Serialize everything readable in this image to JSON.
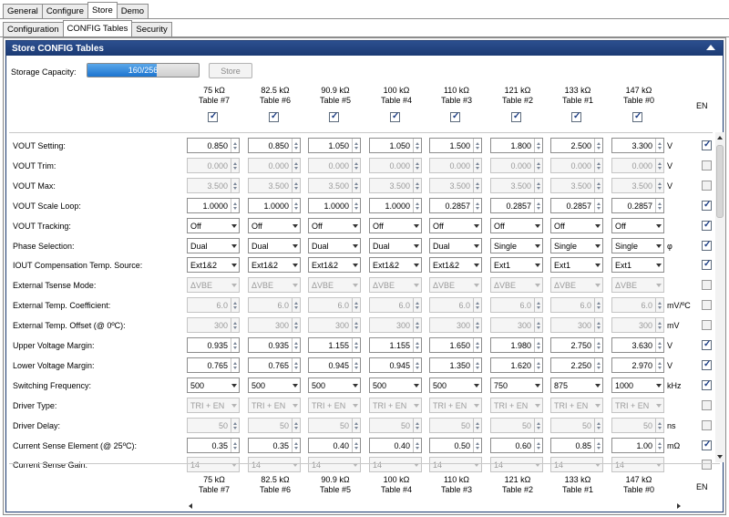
{
  "tabs_top": [
    {
      "label": "General",
      "active": false
    },
    {
      "label": "Configure",
      "active": false
    },
    {
      "label": "Store",
      "active": true
    },
    {
      "label": "Demo",
      "active": false
    }
  ],
  "tabs_sub": [
    {
      "label": "Configuration",
      "active": false
    },
    {
      "label": "CONFIG Tables",
      "active": true
    },
    {
      "label": "Security",
      "active": false
    }
  ],
  "panel": {
    "title": "Store CONFIG Tables"
  },
  "storage": {
    "label": "Storage Capacity:",
    "progress_text": "160/256",
    "used": 160,
    "total": 256,
    "store_button": "Store"
  },
  "columns": [
    {
      "rating": "75 kΩ",
      "table": "Table #7",
      "enabled": true
    },
    {
      "rating": "82.5 kΩ",
      "table": "Table #6",
      "enabled": true
    },
    {
      "rating": "90.9 kΩ",
      "table": "Table #5",
      "enabled": true
    },
    {
      "rating": "100 kΩ",
      "table": "Table #4",
      "enabled": true
    },
    {
      "rating": "110 kΩ",
      "table": "Table #3",
      "enabled": true
    },
    {
      "rating": "121 kΩ",
      "table": "Table #2",
      "enabled": true
    },
    {
      "rating": "133 kΩ",
      "table": "Table #1",
      "enabled": true
    },
    {
      "rating": "147 kΩ",
      "table": "Table #0",
      "enabled": true
    }
  ],
  "en_header": "EN",
  "rows": [
    {
      "label": "VOUT Setting:",
      "type": "spin",
      "enabled": true,
      "unit": "V",
      "en": true,
      "values": [
        "0.850",
        "0.850",
        "1.050",
        "1.050",
        "1.500",
        "1.800",
        "2.500",
        "3.300"
      ]
    },
    {
      "label": "VOUT Trim:",
      "type": "spin",
      "enabled": false,
      "unit": "V",
      "en": false,
      "values": [
        "0.000",
        "0.000",
        "0.000",
        "0.000",
        "0.000",
        "0.000",
        "0.000",
        "0.000"
      ]
    },
    {
      "label": "VOUT Max:",
      "type": "spin",
      "enabled": false,
      "unit": "V",
      "en": false,
      "values": [
        "3.500",
        "3.500",
        "3.500",
        "3.500",
        "3.500",
        "3.500",
        "3.500",
        "3.500"
      ]
    },
    {
      "label": "VOUT Scale Loop:",
      "type": "spin",
      "enabled": true,
      "unit": "",
      "en": true,
      "values": [
        "1.0000",
        "1.0000",
        "1.0000",
        "1.0000",
        "0.2857",
        "0.2857",
        "0.2857",
        "0.2857"
      ]
    },
    {
      "label": "VOUT Tracking:",
      "type": "select",
      "enabled": true,
      "unit": "",
      "en": true,
      "values": [
        "Off",
        "Off",
        "Off",
        "Off",
        "Off",
        "Off",
        "Off",
        "Off"
      ]
    },
    {
      "label": "Phase Selection:",
      "type": "select",
      "enabled": true,
      "unit": "φ",
      "en": true,
      "values": [
        "Dual",
        "Dual",
        "Dual",
        "Dual",
        "Dual",
        "Single",
        "Single",
        "Single"
      ]
    },
    {
      "label": "IOUT Compensation Temp. Source:",
      "type": "select",
      "enabled": true,
      "unit": "",
      "en": true,
      "values": [
        "Ext1&2",
        "Ext1&2",
        "Ext1&2",
        "Ext1&2",
        "Ext1&2",
        "Ext1",
        "Ext1",
        "Ext1"
      ]
    },
    {
      "label": "External Tsense Mode:",
      "type": "select",
      "enabled": false,
      "unit": "",
      "en": false,
      "values": [
        "ΔVBE",
        "ΔVBE",
        "ΔVBE",
        "ΔVBE",
        "ΔVBE",
        "ΔVBE",
        "ΔVBE",
        "ΔVBE"
      ]
    },
    {
      "label": "External Temp. Coefficient:",
      "type": "spin",
      "enabled": false,
      "unit": "mV/ºC",
      "en": false,
      "values": [
        "6.0",
        "6.0",
        "6.0",
        "6.0",
        "6.0",
        "6.0",
        "6.0",
        "6.0"
      ]
    },
    {
      "label": "External Temp. Offset (@ 0ºC):",
      "type": "spin",
      "enabled": false,
      "unit": "mV",
      "en": false,
      "values": [
        "300",
        "300",
        "300",
        "300",
        "300",
        "300",
        "300",
        "300"
      ]
    },
    {
      "label": "Upper Voltage Margin:",
      "type": "spin",
      "enabled": true,
      "unit": "V",
      "en": true,
      "values": [
        "0.935",
        "0.935",
        "1.155",
        "1.155",
        "1.650",
        "1.980",
        "2.750",
        "3.630"
      ]
    },
    {
      "label": "Lower Voltage Margin:",
      "type": "spin",
      "enabled": true,
      "unit": "V",
      "en": true,
      "values": [
        "0.765",
        "0.765",
        "0.945",
        "0.945",
        "1.350",
        "1.620",
        "2.250",
        "2.970"
      ]
    },
    {
      "label": "Switching Frequency:",
      "type": "select",
      "enabled": true,
      "unit": "kHz",
      "en": true,
      "values": [
        "500",
        "500",
        "500",
        "500",
        "500",
        "750",
        "875",
        "1000"
      ]
    },
    {
      "label": "Driver Type:",
      "type": "select",
      "enabled": false,
      "unit": "",
      "en": false,
      "values": [
        "TRI + EN",
        "TRI + EN",
        "TRI + EN",
        "TRI + EN",
        "TRI + EN",
        "TRI + EN",
        "TRI + EN",
        "TRI + EN"
      ]
    },
    {
      "label": "Driver Delay:",
      "type": "spin",
      "enabled": false,
      "unit": "ns",
      "en": false,
      "values": [
        "50",
        "50",
        "50",
        "50",
        "50",
        "50",
        "50",
        "50"
      ]
    },
    {
      "label": "Current Sense Element (@ 25ºC):",
      "type": "spin",
      "enabled": true,
      "unit": "mΩ",
      "en": true,
      "values": [
        "0.35",
        "0.35",
        "0.40",
        "0.40",
        "0.50",
        "0.60",
        "0.85",
        "1.00"
      ]
    },
    {
      "label": "Current Sense Gain:",
      "type": "select",
      "enabled": false,
      "unit": "",
      "en": false,
      "values": [
        "14",
        "14",
        "14",
        "14",
        "14",
        "14",
        "14",
        "14"
      ]
    }
  ],
  "colors": {
    "title_bar": "#1f3d73",
    "progress_fill": "#1c74cf",
    "check": "#1e3f85"
  }
}
